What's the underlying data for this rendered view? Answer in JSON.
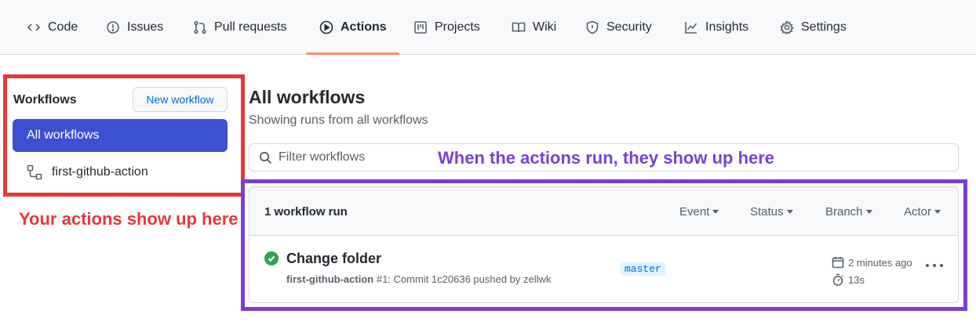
{
  "nav": {
    "tabs": [
      {
        "label": "Code",
        "icon": "code-icon"
      },
      {
        "label": "Issues",
        "icon": "issue-icon"
      },
      {
        "label": "Pull requests",
        "icon": "pull-request-icon"
      },
      {
        "label": "Actions",
        "icon": "play-icon",
        "active": true
      },
      {
        "label": "Projects",
        "icon": "project-icon"
      },
      {
        "label": "Wiki",
        "icon": "book-icon"
      },
      {
        "label": "Security",
        "icon": "shield-icon"
      },
      {
        "label": "Insights",
        "icon": "graph-icon"
      },
      {
        "label": "Settings",
        "icon": "gear-icon"
      }
    ]
  },
  "sidebar": {
    "heading": "Workflows",
    "new_workflow_label": "New workflow",
    "all_workflows_label": "All workflows",
    "items": [
      {
        "label": "first-github-action",
        "icon": "workflow-icon"
      }
    ]
  },
  "annotations": {
    "left_note": "Your actions show up here",
    "right_note": "When the actions run, they show up here",
    "left_color": "#e5383b",
    "right_color": "#7b3fd4"
  },
  "main": {
    "title": "All workflows",
    "subtitle": "Showing runs from all workflows",
    "filter_placeholder": "Filter workflows",
    "runs": {
      "count_label": "1 workflow run",
      "filters": [
        "Event",
        "Status",
        "Branch",
        "Actor"
      ],
      "rows": [
        {
          "title": "Change folder",
          "status": "success",
          "workflow": "first-github-action",
          "meta": "#1: Commit 1c20636 pushed by zellwk",
          "branch": "master",
          "time_ago": "2 minutes ago",
          "duration": "13s"
        }
      ]
    }
  },
  "colors": {
    "accent_active": "#3d4fd3",
    "tab_underline": "#fd8c73",
    "success": "#2da44e"
  }
}
